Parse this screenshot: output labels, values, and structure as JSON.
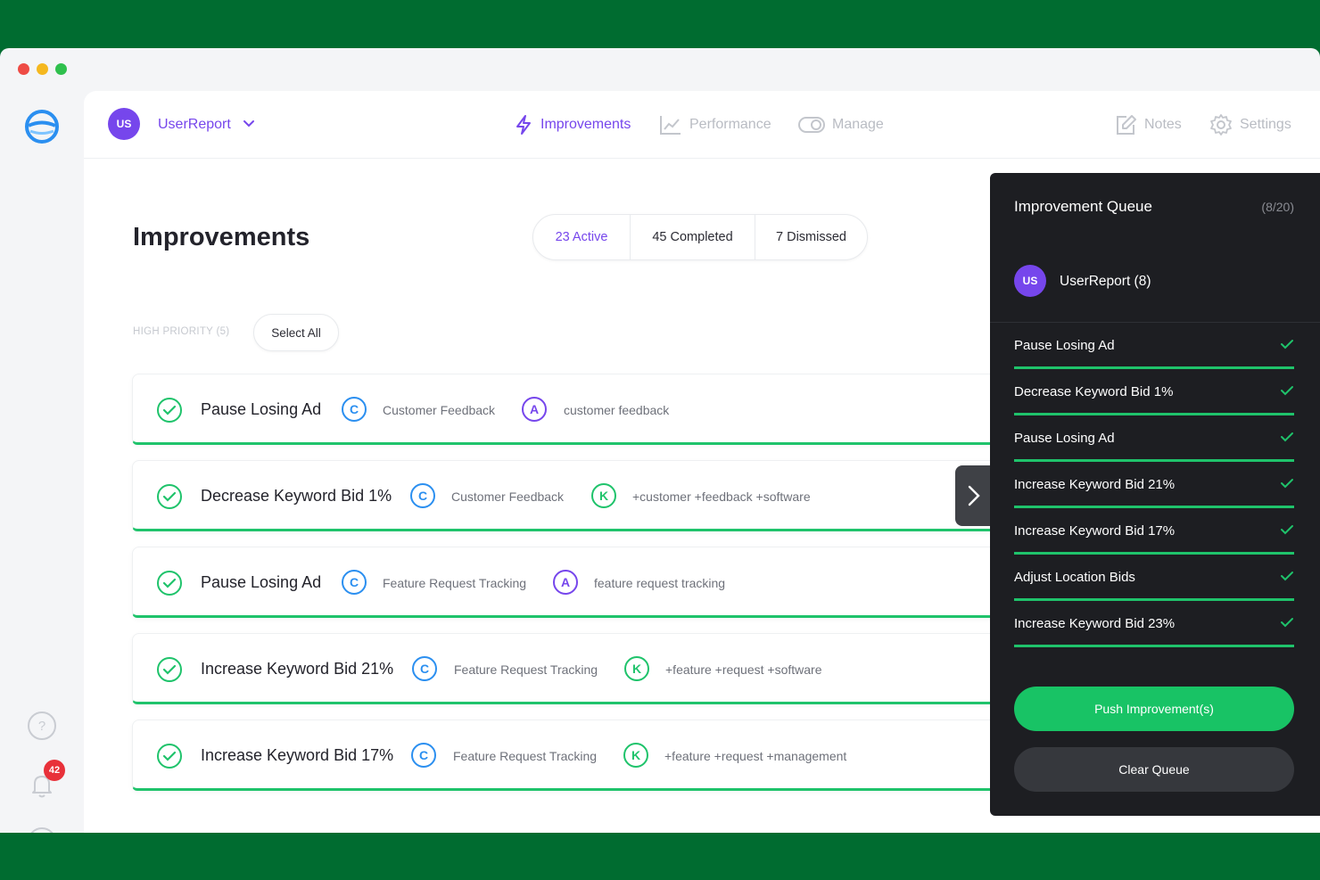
{
  "account": {
    "initials": "US",
    "name": "UserReport"
  },
  "nav": {
    "improvements": "Improvements",
    "performance": "Performance",
    "manage": "Manage",
    "notes": "Notes",
    "settings": "Settings"
  },
  "notifications": {
    "count": "42"
  },
  "page": {
    "title": "Improvements"
  },
  "filters": {
    "active": "23 Active",
    "completed": "45 Completed",
    "dismissed": "7 Dismissed"
  },
  "section": {
    "label": "HIGH PRIORITY (5)",
    "select_all": "Select All"
  },
  "rows": [
    {
      "title": "Pause Losing Ad",
      "campaign_icon": "C",
      "campaign": "Customer Feedback",
      "target_icon": "A",
      "target": "customer feedback"
    },
    {
      "title": "Decrease Keyword Bid 1%",
      "campaign_icon": "C",
      "campaign": "Customer Feedback",
      "target_icon": "K",
      "target": "+customer +feedback +software"
    },
    {
      "title": "Pause Losing Ad",
      "campaign_icon": "C",
      "campaign": "Feature Request Tracking",
      "target_icon": "A",
      "target": "feature request tracking"
    },
    {
      "title": "Increase Keyword Bid 21%",
      "campaign_icon": "C",
      "campaign": "Feature Request Tracking",
      "target_icon": "K",
      "target": "+feature +request +software"
    },
    {
      "title": "Increase Keyword Bid 17%",
      "campaign_icon": "C",
      "campaign": "Feature Request Tracking",
      "target_icon": "K",
      "target": "+feature +request +management"
    }
  ],
  "queue": {
    "title": "Improvement Queue",
    "count": "(8/20)",
    "account_initials": "US",
    "account": "UserReport (8)",
    "items": [
      "Pause Losing Ad",
      "Decrease Keyword Bid 1%",
      "Pause Losing Ad",
      "Increase Keyword Bid 21%",
      "Increase Keyword Bid 17%",
      "Adjust Location Bids",
      "Increase Keyword Bid 23%"
    ],
    "push": "Push Improvement(s)",
    "clear": "Clear Queue"
  },
  "colors": {
    "background": "#006c30",
    "brand_purple": "#7646ec",
    "success_green": "#1fc36b",
    "campaign_blue": "#2b8ff0",
    "queue_panel": "#1d1e22",
    "badge_red": "#e8313a"
  },
  "icons": {
    "logo": "app-logo-icon",
    "help": "help-icon",
    "notifications": "bell-icon",
    "profile": "user-icon",
    "improvements": "lightning-icon",
    "performance": "chart-icon",
    "manage": "toggle-icon",
    "notes": "edit-icon",
    "settings": "gear-icon",
    "row_status": "check-circle-icon",
    "collapse": "chevron-right-icon"
  }
}
